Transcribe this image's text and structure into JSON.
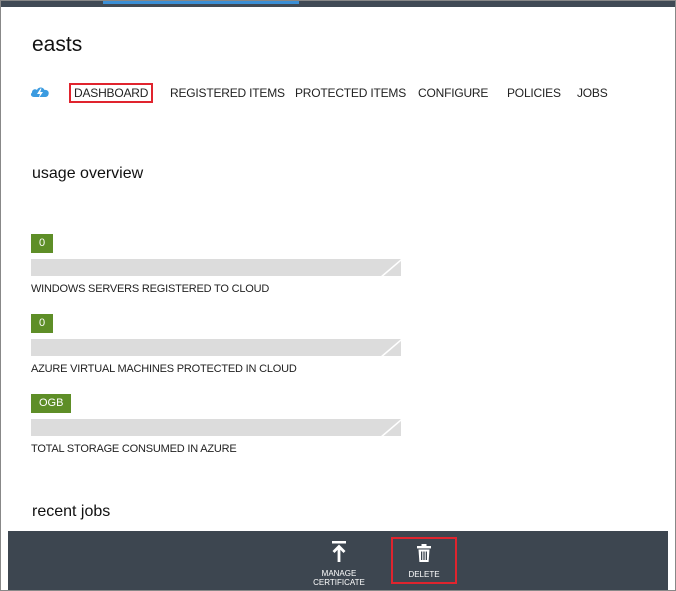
{
  "page": {
    "title": "easts"
  },
  "nav": {
    "items": [
      {
        "label": "DASHBOARD",
        "active": true
      },
      {
        "label": "REGISTERED ITEMS",
        "active": false
      },
      {
        "label": "PROTECTED ITEMS",
        "active": false
      },
      {
        "label": "CONFIGURE",
        "active": false
      },
      {
        "label": "POLICIES",
        "active": false
      },
      {
        "label": "JOBS",
        "active": false
      }
    ],
    "icon": "cloud-vault-icon"
  },
  "usage": {
    "title": "usage overview",
    "metrics": [
      {
        "value": "0",
        "label": "WINDOWS SERVERS REGISTERED TO CLOUD"
      },
      {
        "value": "0",
        "label": "AZURE VIRTUAL MACHINES PROTECTED IN CLOUD"
      },
      {
        "value": "OGB",
        "label": "TOTAL STORAGE CONSUMED IN AZURE"
      }
    ]
  },
  "recent_jobs": {
    "title": "recent jobs"
  },
  "commands": {
    "manage_certificate": {
      "label_line1": "MANAGE",
      "label_line2": "CERTIFICATE",
      "icon": "upload-arrow-icon"
    },
    "delete": {
      "label": "DELETE",
      "icon": "trash-icon"
    }
  },
  "colors": {
    "accent_green": "#5e8e27",
    "command_bar": "#3d4650",
    "highlight_red": "#e0242e",
    "bar_gray": "#dcdcdc"
  }
}
